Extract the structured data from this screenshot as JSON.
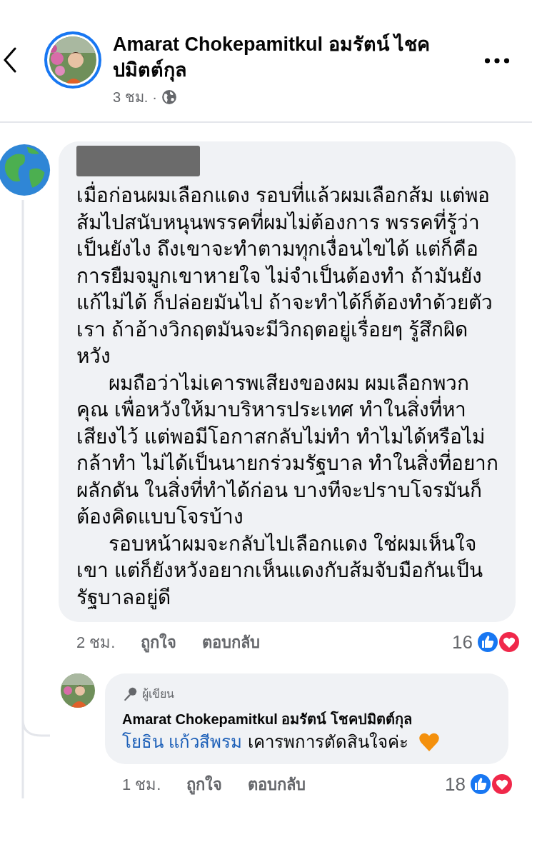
{
  "header": {
    "author": "Amarat Chokepamitkul อมรัตน์ ไชค ปมิตต์กุล",
    "time": "3 ชม.",
    "separator": "·"
  },
  "comment": {
    "name_redacted": true,
    "paragraphs": [
      "เมื่อก่อนผมเลือกแดง รอบที่แล้วผมเลือกส้ม แต่พอส้มไปสนับหนุนพรรคที่ผมไม่ต้องการ พรรคที่รู้ว่าเป็นยังไง ถึงเขาจะทำตามทุกเงื่อนไขได้ แต่ก็คือการยืมจมูกเขาหายใจ ไม่จำเป็นต้องทำ ถ้ามันยังแก้ไม่ได้ ก็ปล่อยมันไป ถ้าจะทำได้ก็ต้องทำด้วยตัวเรา ถ้าอ้างวิกฤตมันจะมีวิกฤตอยู่เรื่อยๆ รู้สึกผิดหวัง",
      "ผมถือว่าไม่เคารพเสียงของผม  ผมเลือกพวกคุณ เพื่อหวังให้มาบริหารประเทศ ทำในสิ่งที่หาเสียงไว้ แต่พอมีโอกาสกลับไม่ทำ ทำไมได้หรือไม่กล้าทำ ไม่ได้เป็นนายกร่วมรัฐบาล ทำในสิ่งที่อยากผลักดัน ในสิ่งที่ทำได้ก่อน  บางทีจะปราบโจรมันก็ต้องคิดแบบโจรบ้าง",
      "รอบหน้าผมจะกลับไปเลือกแดง ใช่ผมเห็นใจเขา แต่ก็ยังหวังอยากเห็นแดงกับส้มจับมือกันเป็นรัฐบาลอยู่ดี"
    ],
    "time": "2 ชม.",
    "actions": [
      "ถูกใจ",
      "ตอบกลับ"
    ],
    "reaction_count": "16"
  },
  "reply": {
    "badge": "ผู้เขียน",
    "author": "Amarat Chokepamitkul อมรัตน์ โชคปมิตต์กุล",
    "mention": "โยธิน แก้วสีพรม",
    "text": "เคารพการตัดสินใจค่ะ",
    "time": "1 ชม.",
    "actions": [
      "ถูกใจ",
      "ตอบกลับ"
    ],
    "reaction_count": "18"
  }
}
